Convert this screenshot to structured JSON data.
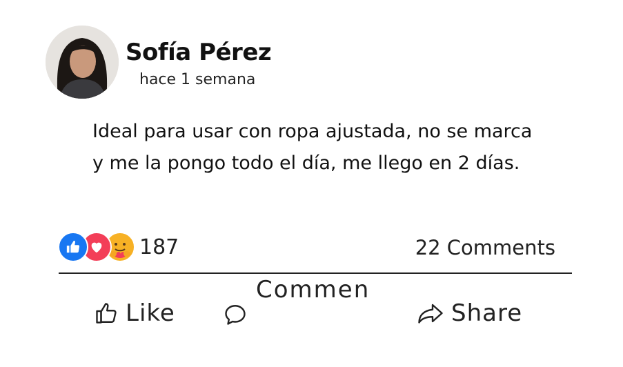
{
  "post": {
    "author": "Sofía Pérez",
    "timestamp": "hace 1 semana",
    "text": "Ideal para usar con ropa ajustada, no se marca y me la pongo todo el día, me llego en 2 días."
  },
  "stats": {
    "reaction_icons": [
      "like-icon",
      "love-icon",
      "care-icon"
    ],
    "reaction_count": "187",
    "comments_count": "22 Comments"
  },
  "actions": {
    "like_label": "Like",
    "comment_label": "Commen",
    "share_label": "Share"
  },
  "colors": {
    "like": "#1877f2",
    "love": "#f33e58",
    "care": "#f7b125"
  }
}
